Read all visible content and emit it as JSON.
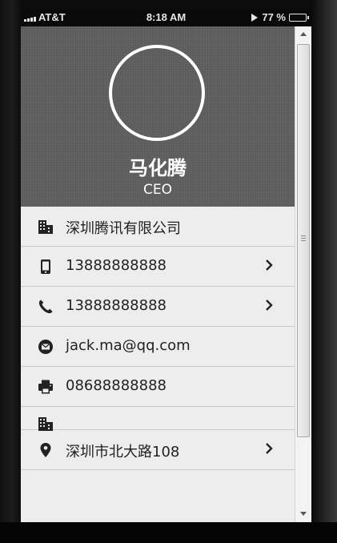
{
  "status_bar": {
    "carrier": "AT&T",
    "time": "8:18 AM",
    "battery_percent": "77 %",
    "battery_level": 0.77
  },
  "profile": {
    "name": "马化腾",
    "title": "CEO"
  },
  "rows": [
    {
      "icon": "building-icon",
      "text": "深圳腾讯有限公司",
      "chevron": false
    },
    {
      "icon": "mobile-phone-icon",
      "text": "13888888888",
      "chevron": true
    },
    {
      "icon": "phone-handset-icon",
      "text": "13888888888",
      "chevron": true
    },
    {
      "icon": "envelope-icon",
      "text": "jack.ma@qq.com",
      "chevron": false
    },
    {
      "icon": "printer-icon",
      "text": "08688888888",
      "chevron": false
    },
    {
      "icon": "building-icon",
      "text": "",
      "chevron": false
    },
    {
      "icon": "map-pin-icon",
      "text": "深圳市北大路108",
      "chevron": true
    }
  ],
  "colors": {
    "header_background": "#5f5f5f",
    "list_background": "#ededed",
    "divider": "#c9c9c9",
    "text": "#222222"
  }
}
